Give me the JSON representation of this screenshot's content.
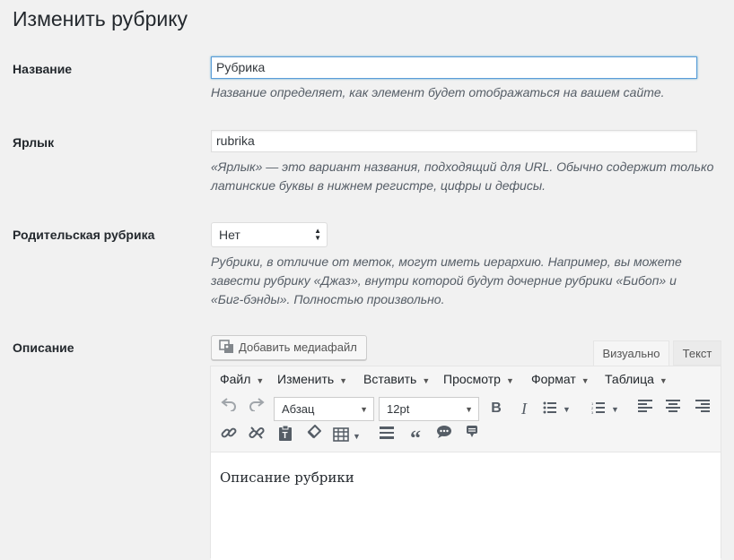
{
  "page": {
    "title": "Изменить рубрику"
  },
  "name_field": {
    "label": "Название",
    "value": "Рубрика",
    "description": "Название определяет, как элемент будет отображаться на вашем сайте."
  },
  "slug_field": {
    "label": "Ярлык",
    "value": "rubrika",
    "description_line1": "«Ярлык» — это вариант названия, подходящий для URL. Обычно содержит только",
    "description_line2": "латинские буквы в нижнем регистре, цифры и дефисы."
  },
  "parent_field": {
    "label": "Родительская рубрика",
    "selected": "Нет",
    "description_line1": "Рубрики, в отличие от меток, могут иметь иерархию. Например, вы можете",
    "description_line2": "завести рубрику «Джаз», внутри которой будут дочерние рубрики «Бибоп» и",
    "description_line3": "«Биг-бэнды». Полностью произвольно."
  },
  "description_field": {
    "label": "Описание",
    "add_media_label": "Добавить медиафайл",
    "tabs": {
      "visual": "Визуально",
      "text": "Текст"
    },
    "menubar": {
      "file": "Файл",
      "edit": "Изменить",
      "insert": "Вставить",
      "view": "Просмотр",
      "format": "Формат",
      "table": "Таблица"
    },
    "toolbar": {
      "block_format": "Абзац",
      "font_size": "12pt",
      "row1_icons": [
        "undo-icon",
        "redo-icon",
        "bold-icon",
        "italic-icon",
        "bullet-list-icon",
        "numbered-list-icon",
        "align-left-icon",
        "align-center-icon",
        "align-right-icon"
      ],
      "row2_icons": [
        "link-icon",
        "unlink-icon",
        "paste-text-icon",
        "clear-formatting-icon",
        "table-icon",
        "horizontal-rule-icon",
        "blockquote-icon",
        "comment-icon",
        "comment-alt-icon"
      ]
    },
    "content": "Описание рубрики"
  },
  "colors": {
    "focus_border": "#5b9dd9",
    "background": "#f1f1f1"
  }
}
